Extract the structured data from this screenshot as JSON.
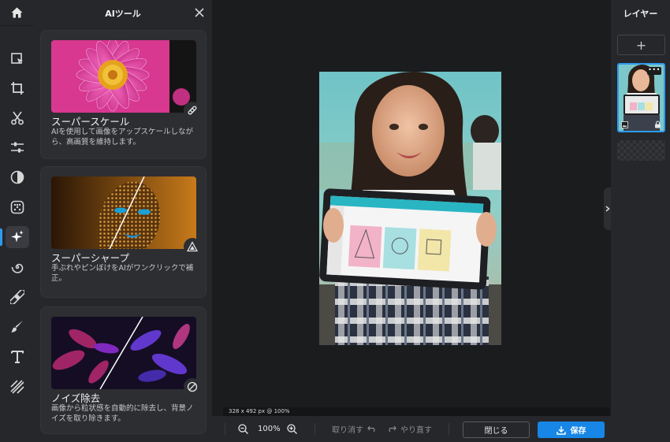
{
  "rail": {
    "tools": [
      {
        "name": "select-icon"
      },
      {
        "name": "crop-icon"
      },
      {
        "name": "cut-icon"
      },
      {
        "name": "adjust-icon"
      },
      {
        "name": "contrast-icon"
      },
      {
        "name": "filter-icon"
      },
      {
        "name": "ai-sparkle-icon",
        "active": true
      },
      {
        "name": "spiral-icon"
      },
      {
        "name": "bandage-icon"
      },
      {
        "name": "brush-icon"
      },
      {
        "name": "text-icon"
      },
      {
        "name": "texture-icon"
      }
    ],
    "active_color": "#2d9bf0"
  },
  "panel": {
    "title": "AIツール",
    "cards": [
      {
        "title": "スーパースケール",
        "desc": "AIを使用して画像をアップスケールしながら、高画質を維持します。",
        "badge": "link-icon"
      },
      {
        "title": "スーパーシャープ",
        "desc": "手ぶれやピンぼけをAIがワンクリックで補正。",
        "badge": "triangle-icon"
      },
      {
        "title": "ノイズ除去",
        "desc": "画像から粒状感を自動的に除去し、背景ノイズを取り除きます。",
        "badge": "slash-circle-icon"
      }
    ]
  },
  "canvas": {
    "dims_label": "328 x 492 px @ 100%"
  },
  "layers": {
    "title": "レイヤー",
    "add_label": "+",
    "menu_label": "•••"
  },
  "bottombar": {
    "zoom": "100%",
    "undo_label": "取り消す",
    "redo_label": "やり直す",
    "close_label": "閉じる",
    "save_label": "保存",
    "save_color": "#1786e6"
  }
}
